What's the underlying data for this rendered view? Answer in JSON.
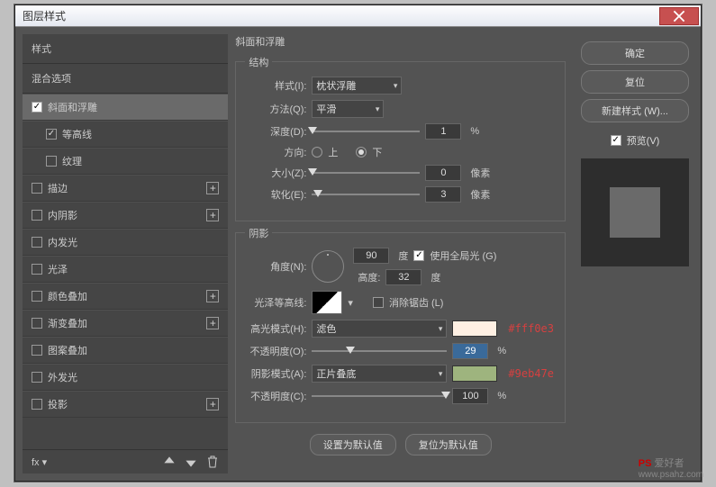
{
  "window": {
    "title": "图层样式"
  },
  "sidebar": {
    "header1": "样式",
    "header2": "混合选项",
    "items": [
      {
        "checked": true,
        "label": "斜面和浮雕",
        "selected": true
      },
      {
        "checked": true,
        "label": "等高线"
      },
      {
        "checked": false,
        "label": "纹理"
      },
      {
        "checked": false,
        "label": "描边",
        "plus": true
      },
      {
        "checked": false,
        "label": "内阴影",
        "plus": true
      },
      {
        "checked": false,
        "label": "内发光"
      },
      {
        "checked": false,
        "label": "光泽"
      },
      {
        "checked": false,
        "label": "颜色叠加",
        "plus": true
      },
      {
        "checked": false,
        "label": "渐变叠加",
        "plus": true
      },
      {
        "checked": false,
        "label": "图案叠加"
      },
      {
        "checked": false,
        "label": "外发光"
      },
      {
        "checked": false,
        "label": "投影",
        "plus": true
      }
    ],
    "fx_label": "fx"
  },
  "settings": {
    "main_title": "斜面和浮雕",
    "structure": {
      "title": "结构",
      "style_label": "样式(I):",
      "style_value": "枕状浮雕",
      "method_label": "方法(Q):",
      "method_value": "平滑",
      "depth_label": "深度(D):",
      "depth_value": "1",
      "depth_unit": "%",
      "direction_label": "方向:",
      "up": "上",
      "down": "下",
      "size_label": "大小(Z):",
      "size_value": "0",
      "size_unit": "像素",
      "soften_label": "软化(E):",
      "soften_value": "3",
      "soften_unit": "像素"
    },
    "shading": {
      "title": "阴影",
      "angle_label": "角度(N):",
      "angle_value": "90",
      "angle_unit": "度",
      "global_light": "使用全局光 (G)",
      "altitude_label": "高度:",
      "altitude_value": "32",
      "altitude_unit": "度",
      "gloss_label": "光泽等高线:",
      "antialias": "消除锯齿 (L)",
      "hl_mode_label": "高光模式(H):",
      "hl_mode_value": "滤色",
      "hl_color": "#fff0e3",
      "hl_hex": "#fff0e3",
      "hl_op_label": "不透明度(O):",
      "hl_op_value": "29",
      "hl_op_unit": "%",
      "sh_mode_label": "阴影模式(A):",
      "sh_mode_value": "正片叠底",
      "sh_color": "#9eb47e",
      "sh_hex": "#9eb47e",
      "sh_op_label": "不透明度(C):",
      "sh_op_value": "100",
      "sh_op_unit": "%"
    },
    "footer": {
      "make_default": "设置为默认值",
      "reset_default": "复位为默认值"
    }
  },
  "rightcol": {
    "ok": "确定",
    "cancel": "复位",
    "new_style": "新建样式 (W)...",
    "preview_label": "预览(V)"
  },
  "watermark": {
    "text1": "PS 爱好者",
    "text2": "www.psahz.com"
  }
}
